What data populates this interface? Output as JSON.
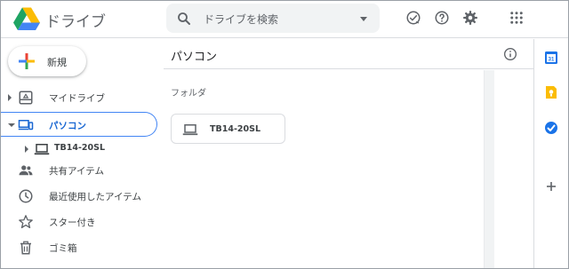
{
  "app": {
    "title": "ドライブ"
  },
  "search": {
    "placeholder": "ドライブを検索"
  },
  "toolbar": {
    "icons": [
      "check-circle-icon",
      "help-icon",
      "settings-icon",
      "apps-grid-icon"
    ]
  },
  "new_button": {
    "label": "新規"
  },
  "sidebar": {
    "items": [
      {
        "label": "マイドライブ",
        "icon": "my-drive-icon",
        "expandable": true,
        "expanded": false
      },
      {
        "label": "パソコン",
        "icon": "computers-icon",
        "expandable": true,
        "expanded": true,
        "active": true
      },
      {
        "label": "共有アイテム",
        "icon": "shared-people-icon"
      },
      {
        "label": "最近使用したアイテム",
        "icon": "clock-icon"
      },
      {
        "label": "スター付き",
        "icon": "star-icon"
      },
      {
        "label": "ゴミ箱",
        "icon": "trash-icon"
      }
    ],
    "sub_item": {
      "label": "TB14-20SL",
      "icon": "laptop-icon"
    }
  },
  "main": {
    "title": "パソコン",
    "section_label": "フォルダ",
    "folders": [
      {
        "label": "TB14-20SL",
        "icon": "laptop-icon"
      }
    ]
  },
  "side_panel": {
    "icons": [
      "calendar-icon",
      "keep-icon",
      "tasks-icon",
      "add-icon"
    ],
    "calendar_day": "31"
  },
  "colors": {
    "accent": "#1967d2",
    "active_border": "#4285f4",
    "search_bg": "#f1f3f4"
  }
}
